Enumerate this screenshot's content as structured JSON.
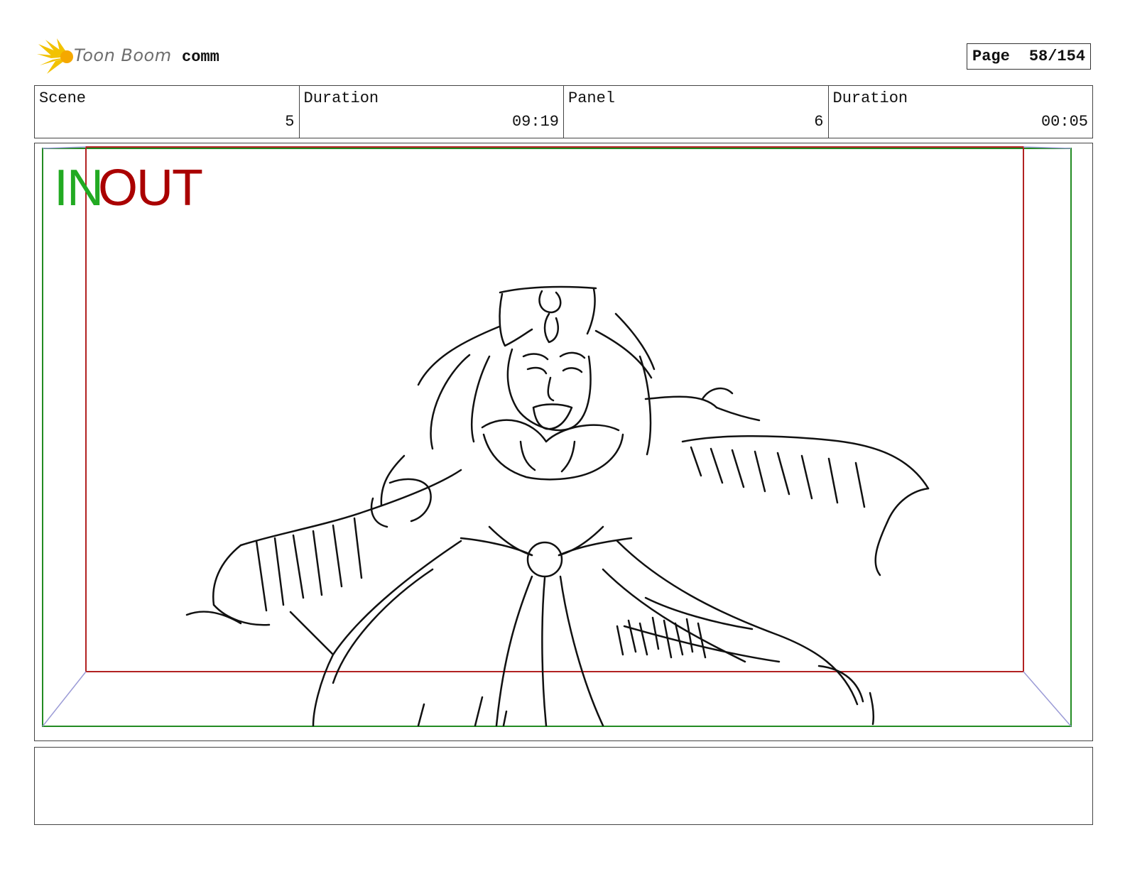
{
  "header": {
    "logo_text": "Toon Boom",
    "project_name": "comm",
    "page_label": "Page",
    "page_number": "58/154"
  },
  "info": {
    "scene_label": "Scene",
    "scene_value": "5",
    "scene_duration_label": "Duration",
    "scene_duration_value": "09:19",
    "panel_label": "Panel",
    "panel_value": "6",
    "panel_duration_label": "Duration",
    "panel_duration_value": "00:05"
  },
  "panel": {
    "in_label": "IN",
    "out_label": "OUT",
    "in_frame_color": "#228B22",
    "out_frame_color": "#B22222"
  },
  "notes": {
    "text": ""
  }
}
